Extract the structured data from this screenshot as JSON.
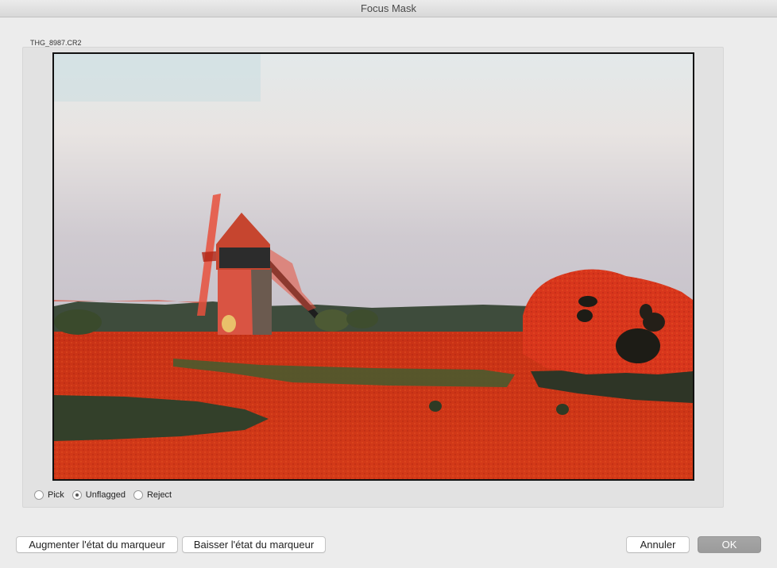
{
  "window": {
    "title": "Focus Mask"
  },
  "image": {
    "filename": "THG_8987.CR2"
  },
  "flag_options": [
    {
      "label": "Pick",
      "selected": false
    },
    {
      "label": "Unflagged",
      "selected": true
    },
    {
      "label": "Reject",
      "selected": false
    }
  ],
  "buttons": {
    "increase_flag": "Augmenter l'état du marqueur",
    "decrease_flag": "Baisser l'état du marqueur",
    "cancel": "Annuler",
    "ok": "OK"
  },
  "colors": {
    "mask_red": "#e02a18",
    "sky_top": "#dfe6ea",
    "sky_bottom": "#c7c3cb"
  }
}
